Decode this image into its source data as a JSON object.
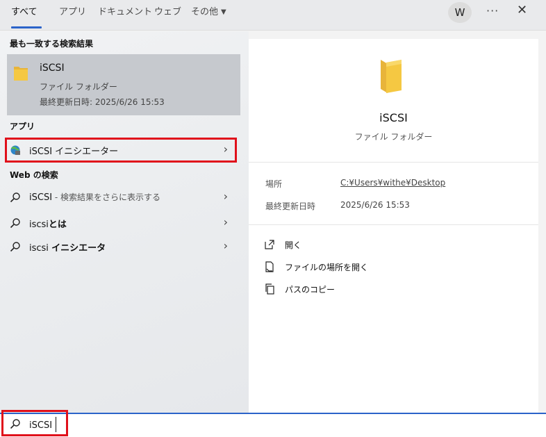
{
  "tabs": [
    {
      "label": "すべて",
      "active": true
    },
    {
      "label": "アプリ"
    },
    {
      "label": "ドキュメント"
    },
    {
      "label": "ウェブ"
    },
    {
      "label": "その他"
    }
  ],
  "account": {
    "initial": "W"
  },
  "top_actions": {
    "more": "···",
    "close": "✕"
  },
  "best_match": {
    "heading": "最も一致する検索結果",
    "name": "iSCSI",
    "type": "ファイル フォルダー",
    "modified": "最終更新日時: 2025/6/26 15:53"
  },
  "apps": {
    "heading": "アプリ",
    "items": [
      {
        "label": "iSCSI イニシエーター"
      }
    ]
  },
  "web": {
    "heading": "Web の検索",
    "items": [
      {
        "label": "iSCSI",
        "suffix": " - 検索結果をさらに表示する"
      },
      {
        "label_plain": "iscsi",
        "label_bold": "とは"
      },
      {
        "label_plain": "iscsi ",
        "label_bold": "イニシエータ"
      }
    ]
  },
  "preview": {
    "title": "iSCSI",
    "subtitle": "ファイル フォルダー",
    "location_label": "場所",
    "location_value": "C:¥Users¥withe¥Desktop",
    "modified_label": "最終更新日時",
    "modified_value": "2025/6/26 15:53",
    "actions": [
      {
        "label": "開く",
        "icon": "open-external-icon"
      },
      {
        "label": "ファイルの場所を開く",
        "icon": "file-location-icon"
      },
      {
        "label": "パスのコピー",
        "icon": "copy-icon"
      }
    ]
  },
  "search": {
    "value": "iSCSI"
  },
  "colors": {
    "accent": "#2b63c9",
    "highlight": "#e0101b",
    "folder": "#f5c842"
  }
}
